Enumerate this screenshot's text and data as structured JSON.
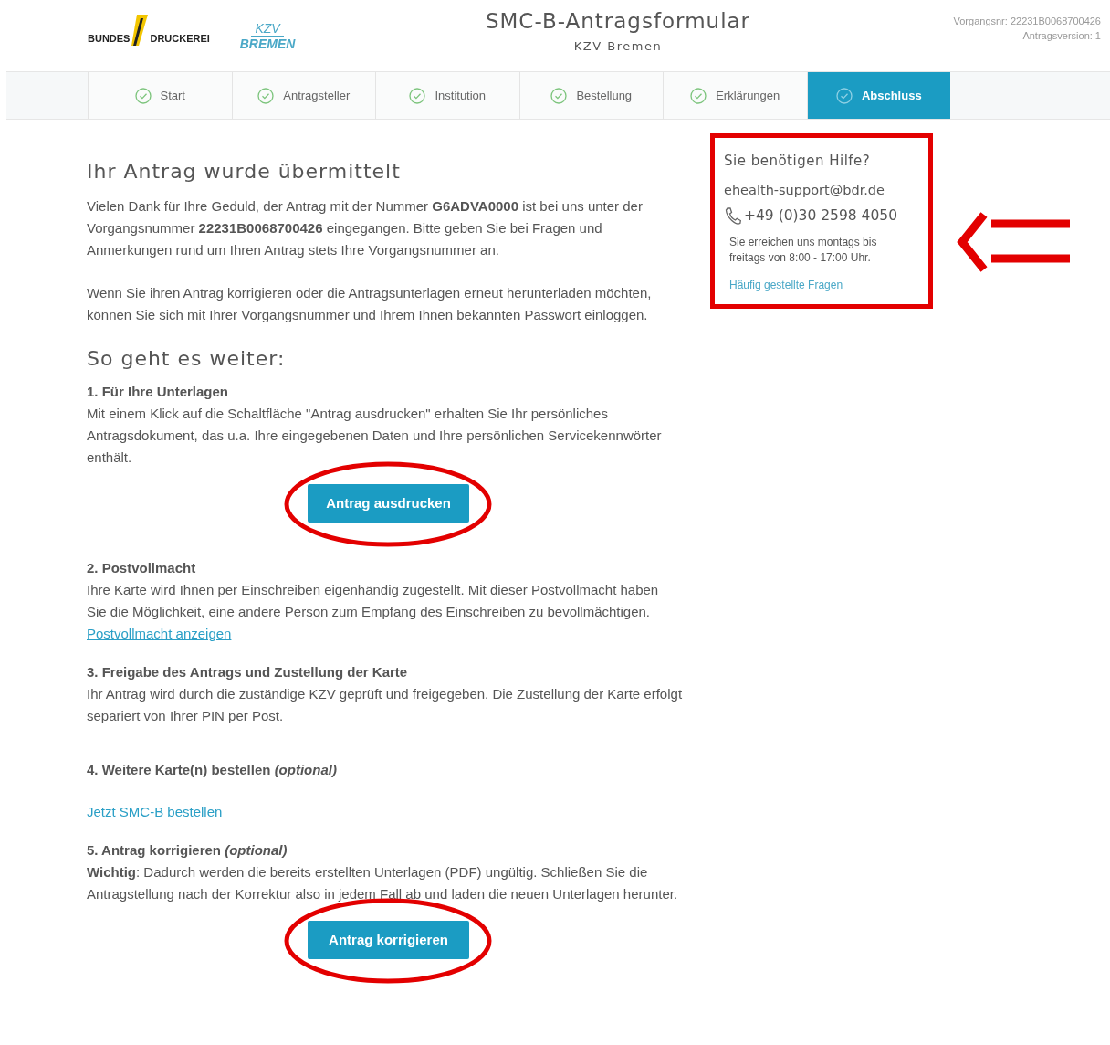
{
  "header": {
    "logo_left": [
      "BUNDES",
      "DRUCKEREI"
    ],
    "logo_right": [
      "KZV",
      "BREMEN"
    ],
    "title": "SMC-B-Antragsformular",
    "subtitle": "KZV Bremen",
    "meta": [
      "Vorgangsnr: 22231B0068700426",
      "Antragsversion: 1"
    ]
  },
  "steps": [
    {
      "label": "Start",
      "selected": false
    },
    {
      "label": "Antragsteller",
      "selected": false
    },
    {
      "label": "Institution",
      "selected": false
    },
    {
      "label": "Bestellung",
      "selected": false
    },
    {
      "label": "Erklärungen",
      "selected": false
    },
    {
      "label": "Abschluss",
      "selected": true
    }
  ],
  "main": {
    "title": "Ihr Antrag wurde übermittelt",
    "paragraphs": [
      "Vielen Dank für Ihre Geduld, der Antrag mit der Nummer **G6ADVA0000** ist bei uns unter der Vorgangsnummer **22231B0068700426** eingegangen. Bitte geben Sie bei Fragen und Anmerkungen rund um Ihren Antrag stets Ihre Vorgangsnummer an.",
      "Wenn Sie ihren Antrag korrigieren oder die Antragsunterlagen erneut herunterladen möchten, können Sie sich mit Ihrer Vorgangsnummer und Ihrem Ihnen bekannten Passwort einloggen."
    ],
    "subtitle": "So geht es weiter:"
  },
  "items": [
    {
      "title": "1. Für Ihre Unterlagen",
      "text": "Mit einem Klick auf die Schaltfläche \"Antrag ausdrucken\" erhalten Sie Ihr persönliches Antragsdokument, das u.a. Ihre eingegebenen Daten und Ihre persönlichen Servicekennwörter enthält.",
      "button": {
        "label": "Antrag ausdrucken",
        "circled": true
      },
      "divider_after": false
    },
    {
      "title": "2. Postvollmacht",
      "text": "Ihre Karte wird Ihnen per Einschreiben eigenhändig zugestellt. Mit dieser Postvollmacht haben Sie die Möglichkeit, eine andere Person zum Empfang des Einschreiben zu bevollmächtigen.",
      "link": "Postvollmacht anzeigen",
      "divider_after": false
    },
    {
      "title": "3. Freigabe des Antrags und Zustellung der Karte",
      "text": "Ihr Antrag wird durch die zuständige KZV geprüft und freigegeben. Die Zustellung der Karte erfolgt separiert von Ihrer PIN per Post.",
      "divider_after": true
    },
    {
      "title": "4. Weitere Karte(n) bestellen",
      "note": "(optional)",
      "link": "Jetzt SMC-B bestellen",
      "divider_after": false
    },
    {
      "title": "5. Antrag korrigieren",
      "note": "(optional)",
      "text": "**Wichtig**: Dadurch werden die bereits erstellten Unterlagen (PDF) ungültig. Schließen Sie die Antragstellung nach der Korrektur also in jedem Fall ab und laden die neuen Unterlagen herunter.",
      "button": {
        "label": "Antrag korrigieren",
        "circled": true
      },
      "divider_after": false
    }
  ],
  "help": {
    "title": "Sie benötigen Hilfe?",
    "email": "ehealth-support@bdr.de",
    "phone": "+49 (0)30 2598 4050",
    "hours": "Sie erreichen uns montags bis freitags von 8:00 - 17:00 Uhr.",
    "link": "Häufig gestellte Fragen",
    "highlighted": true,
    "arrow": true
  }
}
